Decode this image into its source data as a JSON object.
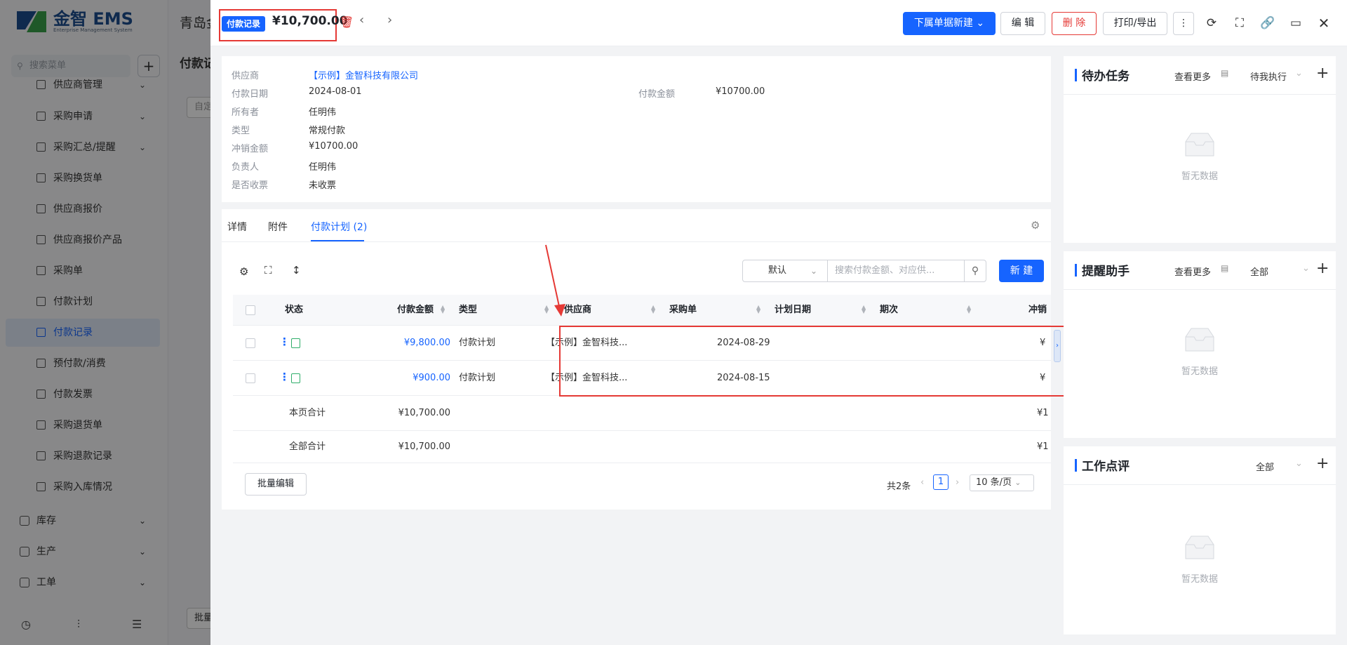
{
  "app": {
    "logo_name": "金智 EMS",
    "logo_sub": "Enterprise Management System",
    "bg_title": "青岛金",
    "bg_sub_title": "付款记",
    "bg_filter": "自定",
    "bg_batch": "批量"
  },
  "sidebar": {
    "search_placeholder": "搜索菜单",
    "items": [
      {
        "label": "供应商管理"
      },
      {
        "label": "采购申请"
      },
      {
        "label": "采购汇总/提醒"
      },
      {
        "label": "采购换货单"
      },
      {
        "label": "供应商报价"
      },
      {
        "label": "供应商报价产品"
      },
      {
        "label": "采购单"
      },
      {
        "label": "付款计划"
      },
      {
        "label": "付款记录"
      },
      {
        "label": "预付款/消费"
      },
      {
        "label": "付款发票"
      },
      {
        "label": "采购退货单"
      },
      {
        "label": "采购退款记录"
      },
      {
        "label": "采购入库情况"
      }
    ],
    "groups": [
      {
        "label": "库存"
      },
      {
        "label": "生产"
      },
      {
        "label": "工单"
      }
    ]
  },
  "header": {
    "tag": "付款记录",
    "amount": "¥10,700.00",
    "new_sub_btn": "下属单据新建",
    "edit_btn": "编 辑",
    "delete_btn": "删 除",
    "print_btn": "打印/导出"
  },
  "info": {
    "supplier_k": "供应商",
    "supplier_v": "【示例】金智科技有限公司",
    "date_k": "付款日期",
    "date_v": "2024-08-01",
    "amount_k": "付款金额",
    "amount_v": "¥10700.00",
    "owner_k": "所有者",
    "owner_v": "任明伟",
    "type_k": "类型",
    "type_v": "常规付款",
    "offset_k": "冲销金额",
    "offset_v": "¥10700.00",
    "resp_k": "负责人",
    "resp_v": "任明伟",
    "invoice_k": "是否收票",
    "invoice_v": "未收票"
  },
  "tabs": [
    {
      "label": "详情"
    },
    {
      "label": "附件"
    },
    {
      "label": "付款计划 (2)"
    }
  ],
  "toolbar": {
    "view_select": "默认",
    "search_placeholder": "搜索付款金额、对应供...",
    "new_btn": "新 建"
  },
  "table": {
    "headers": [
      "状态",
      "付款金额",
      "类型",
      "供应商",
      "采购单",
      "计划日期",
      "期次",
      "冲销"
    ],
    "rows": [
      {
        "amount": "¥9,800.00",
        "type": "付款计划",
        "supplier": "【示例】金智科技...",
        "order": "",
        "date": "2024-08-29",
        "period": "",
        "offset": "¥"
      },
      {
        "amount": "¥900.00",
        "type": "付款计划",
        "supplier": "【示例】金智科技...",
        "order": "",
        "date": "2024-08-15",
        "period": "",
        "offset": "¥"
      }
    ],
    "page_total_label": "本页合计",
    "page_total": "¥10,700.00",
    "page_total_offset": "¥1",
    "all_total_label": "全部合计",
    "all_total": "¥10,700.00",
    "all_total_offset": "¥1"
  },
  "footer": {
    "batch_btn": "批量编辑",
    "total": "共2条",
    "page": "1",
    "page_size": "10 条/页"
  },
  "right": {
    "todo": {
      "title": "待办任务",
      "more": "查看更多",
      "filter": "待我执行",
      "empty": "暂无数据"
    },
    "remind": {
      "title": "提醒助手",
      "more": "查看更多",
      "filter": "全部",
      "empty": "暂无数据"
    },
    "review": {
      "title": "工作点评",
      "filter": "全部",
      "empty": "暂无数据"
    }
  },
  "colors": {
    "primary": "#1664ff",
    "danger": "#e53935",
    "link": "#1664ff"
  }
}
